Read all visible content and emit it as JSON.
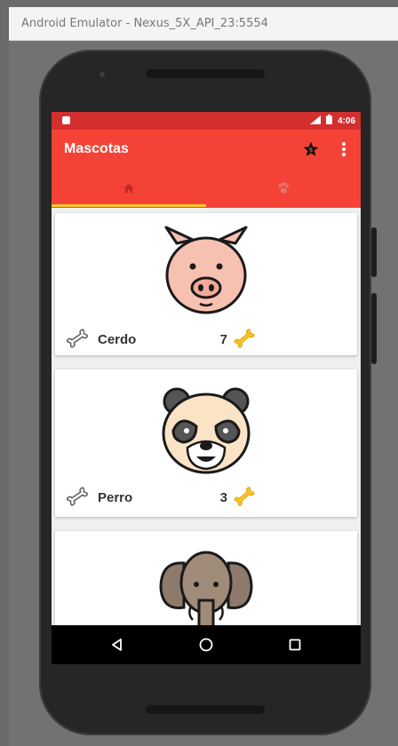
{
  "window": {
    "title": "Android Emulator - Nexus_5X_API_23:5554"
  },
  "status_bar": {
    "time": "4:06",
    "bg_color": "#d32f2f"
  },
  "app_bar": {
    "title": "Mascotas",
    "bg_color": "#f44336",
    "actions": [
      {
        "icon": "star-icon"
      },
      {
        "icon": "overflow-menu-icon"
      }
    ]
  },
  "tabs": [
    {
      "icon": "home-icon",
      "selected": true
    },
    {
      "icon": "paw-icon",
      "selected": false
    }
  ],
  "tab_indicator_color": "#ffca28",
  "pets": [
    {
      "name": "Cerdo",
      "count": "7",
      "image": "pig"
    },
    {
      "name": "Perro",
      "count": "3",
      "image": "panda"
    },
    {
      "name": "",
      "count": "",
      "image": "elephant"
    }
  ],
  "nav_bar": {
    "buttons": [
      "back",
      "home",
      "recents"
    ]
  }
}
